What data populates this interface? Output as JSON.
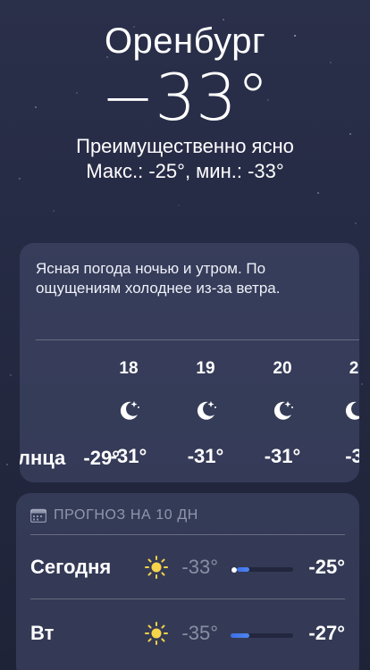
{
  "current": {
    "city": "Оренбург",
    "temperature": "−33°",
    "condition": "Преимущественно ясно",
    "range": "Макс.: -25°, мин.: -33°"
  },
  "hourly": {
    "summary": "Ясная погода ночью и утром. По ощущениям холоднее из-за ветра.",
    "sunset_fragment": "лнца",
    "sunset_temp": "-29°",
    "hours": [
      {
        "label": "18",
        "icon": "moon-stars-icon",
        "temp": "-31°"
      },
      {
        "label": "19",
        "icon": "moon-stars-icon",
        "temp": "-31°"
      },
      {
        "label": "20",
        "icon": "moon-stars-icon",
        "temp": "-31°"
      },
      {
        "label": "2",
        "icon": "moon-stars-icon",
        "temp": "-3"
      }
    ]
  },
  "forecast": {
    "header": "ПРОГНОЗ НА 10 ДН",
    "header_icon": "calendar-icon",
    "days": [
      {
        "day": "Сегодня",
        "icon": "sun-icon",
        "low": "-33°",
        "high": "-25°",
        "bar_start": 0.1,
        "bar_end": 0.3,
        "current_marker": 0.05
      },
      {
        "day": "Вт",
        "icon": "sun-icon",
        "low": "-35°",
        "high": "-27°",
        "bar_start": 0.0,
        "bar_end": 0.3
      }
    ]
  },
  "colors": {
    "background_top": "#2a2f4a",
    "card": "#464c6e",
    "bar_fill": "#4d86f0",
    "sun": "#f5d44a"
  }
}
